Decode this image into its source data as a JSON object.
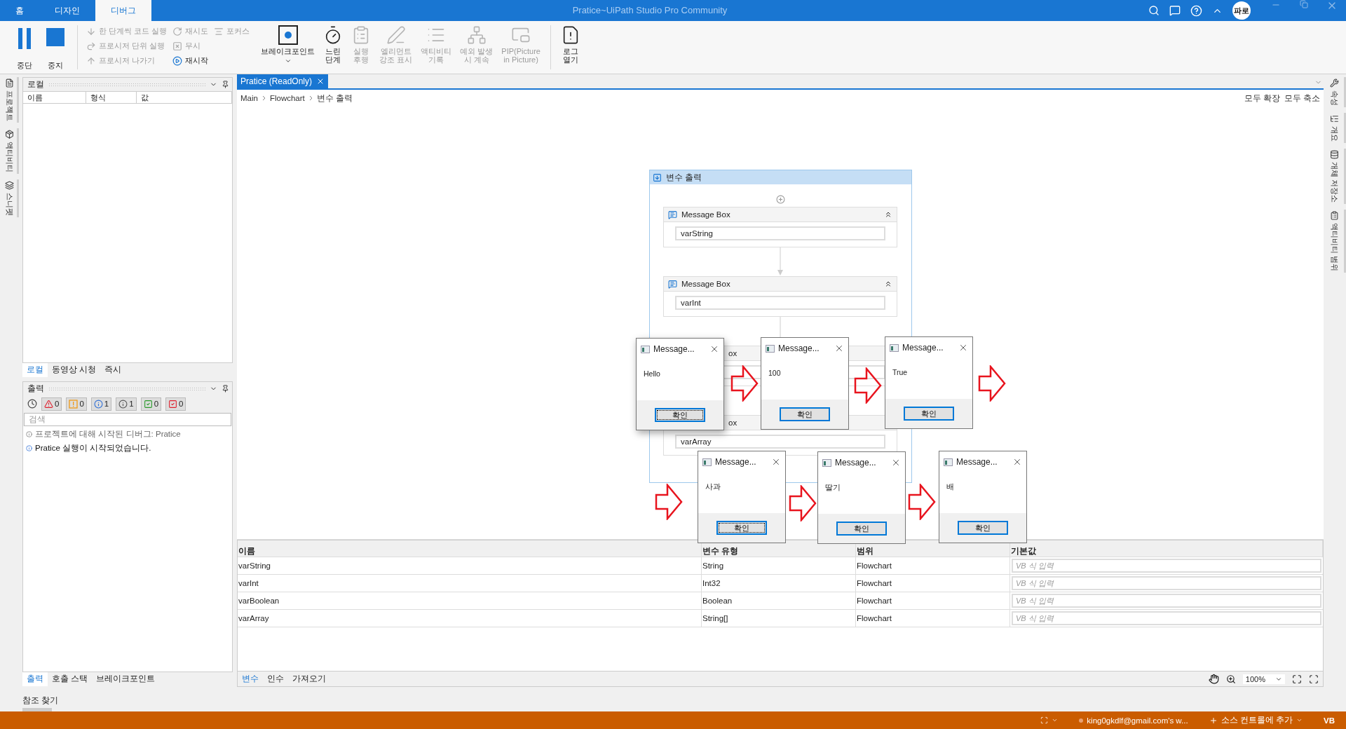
{
  "window": {
    "title": "Pratice~UiPath Studio Pro Community",
    "avatar": "파로"
  },
  "menu_tabs": [
    {
      "label": "홈",
      "selected": false
    },
    {
      "label": "디자인",
      "selected": false
    },
    {
      "label": "디버그",
      "selected": true
    }
  ],
  "ribbon": {
    "run": [
      {
        "kind": "pause",
        "label": "중단"
      },
      {
        "kind": "stop",
        "label": "중지"
      }
    ],
    "step_group": [
      {
        "kind": "step_into",
        "label": "한 단계씩 코드 실행",
        "disabled": true
      },
      {
        "kind": "step_over",
        "label": "프로시저 단위 실행",
        "disabled": true
      },
      {
        "kind": "step_out",
        "label": "프로시저 나가기",
        "disabled": true
      }
    ],
    "retry_group": [
      {
        "kind": "retry",
        "label": "재시도",
        "disabled": true
      },
      {
        "kind": "ignore",
        "label": "무시",
        "disabled": true
      },
      {
        "kind": "restart",
        "label": "재시작",
        "disabled": false
      }
    ],
    "focus_group": [
      {
        "kind": "focus",
        "label": "포커스",
        "disabled": true
      }
    ],
    "tools": [
      {
        "kind": "breakpoint",
        "label": "브레이크포인트",
        "disabled": false,
        "dropdown": true
      },
      {
        "kind": "slow_step",
        "label": "느린\n단계",
        "disabled": false,
        "dropdown": false
      },
      {
        "kind": "trail",
        "label": "실행\n후행",
        "disabled": true,
        "dropdown": false
      },
      {
        "kind": "highlight",
        "label": "엘리먼트\n강조 표시",
        "disabled": true,
        "dropdown": false
      },
      {
        "kind": "log_activity",
        "label": "액티비티\n기록",
        "disabled": true,
        "dropdown": false
      },
      {
        "kind": "continue",
        "label": "예외 발생\n시 계속",
        "disabled": true,
        "dropdown": false
      },
      {
        "kind": "pip",
        "label": "PIP(Picture\nin Picture)",
        "disabled": true,
        "dropdown": false
      }
    ],
    "log": {
      "kind": "open_logs",
      "label": "로그\n열기",
      "disabled": false
    }
  },
  "left_sidebar": [
    {
      "kind": "project",
      "label": "프로젝트"
    },
    {
      "kind": "activities",
      "label": "액티비티"
    },
    {
      "kind": "snippets",
      "label": "스니펫"
    }
  ],
  "right_sidebar": [
    {
      "kind": "properties",
      "label": "속성"
    },
    {
      "kind": "outline",
      "label": "개요"
    },
    {
      "kind": "repository",
      "label": "개체 저장소"
    },
    {
      "kind": "coverage",
      "label": "액티비티 범위"
    }
  ],
  "locals": {
    "title": "로컬",
    "columns": [
      "이름",
      "형식",
      "값"
    ],
    "tabs": [
      {
        "label": "로컬",
        "selected": true
      },
      {
        "label": "동영상 시청",
        "selected": false
      },
      {
        "label": "즉시",
        "selected": false
      }
    ]
  },
  "output": {
    "title": "출력",
    "filters": [
      {
        "kind": "error",
        "count": "0"
      },
      {
        "kind": "warning",
        "count": "0"
      },
      {
        "kind": "info",
        "count": "1"
      },
      {
        "kind": "trace",
        "count": "1"
      },
      {
        "kind": "success",
        "count": "0"
      },
      {
        "kind": "failure",
        "count": "0"
      }
    ],
    "search_placeholder": "검색",
    "entries": [
      {
        "kind": "debug",
        "text": "프로젝트에 대해 시작된 디버그: Pratice"
      },
      {
        "kind": "info",
        "text": "Pratice 실행이 시작되었습니다."
      }
    ],
    "tabs": [
      {
        "label": "출력",
        "selected": true
      },
      {
        "label": "호출 스택",
        "selected": false
      },
      {
        "label": "브레이크포인트",
        "selected": false
      }
    ],
    "find_references": "참조 찾기"
  },
  "document": {
    "tab": "Pratice (ReadOnly)",
    "breadcrumb": [
      "Main",
      "Flowchart",
      "변수 출력"
    ],
    "actions": [
      "모두 확장",
      "모두 축소"
    ]
  },
  "sequence": {
    "title": "변수 출력",
    "activities": [
      {
        "kind": "full",
        "title": "Message Box",
        "value": "varString"
      },
      {
        "kind": "full",
        "title": "Message Box",
        "value": "varInt"
      },
      {
        "kind": "partial",
        "title": "ox"
      },
      {
        "kind": "partial",
        "title": "ox",
        "value": "varArray"
      }
    ]
  },
  "dialogs": [
    {
      "title": "Message...",
      "message": "Hello",
      "button": "확인",
      "focused": true
    },
    {
      "title": "Message...",
      "message": "100",
      "button": "확인",
      "focused": false
    },
    {
      "title": "Message...",
      "message": "True",
      "button": "확인",
      "focused": false
    },
    {
      "title": "Message...",
      "message": "사과",
      "button": "확인",
      "focused": true
    },
    {
      "title": "Message...",
      "message": "딸기",
      "button": "확인",
      "focused": false
    },
    {
      "title": "Message...",
      "message": "배",
      "button": "확인",
      "focused": false
    }
  ],
  "variables": {
    "columns": [
      "이름",
      "변수 유형",
      "범위",
      "기본값"
    ],
    "rows": [
      {
        "name": "varString",
        "type": "String",
        "scope": "Flowchart",
        "default_placeholder": "VB 식 입력"
      },
      {
        "name": "varInt",
        "type": "Int32",
        "scope": "Flowchart",
        "default_placeholder": "VB 식 입력"
      },
      {
        "name": "varBoolean",
        "type": "Boolean",
        "scope": "Flowchart",
        "default_placeholder": "VB 식 입력"
      },
      {
        "name": "varArray",
        "type": "String[]",
        "scope": "Flowchart",
        "default_placeholder": "VB 식 입력"
      }
    ],
    "tabs": [
      {
        "label": "변수",
        "selected": true
      },
      {
        "label": "인수",
        "selected": false
      },
      {
        "label": "가져오기",
        "selected": false
      }
    ],
    "zoom": "100%"
  },
  "status_bar": {
    "account": "king0gkdlf@gmail.com's w...",
    "source_control": "소스 컨트롤에 추가",
    "language": "VB"
  }
}
